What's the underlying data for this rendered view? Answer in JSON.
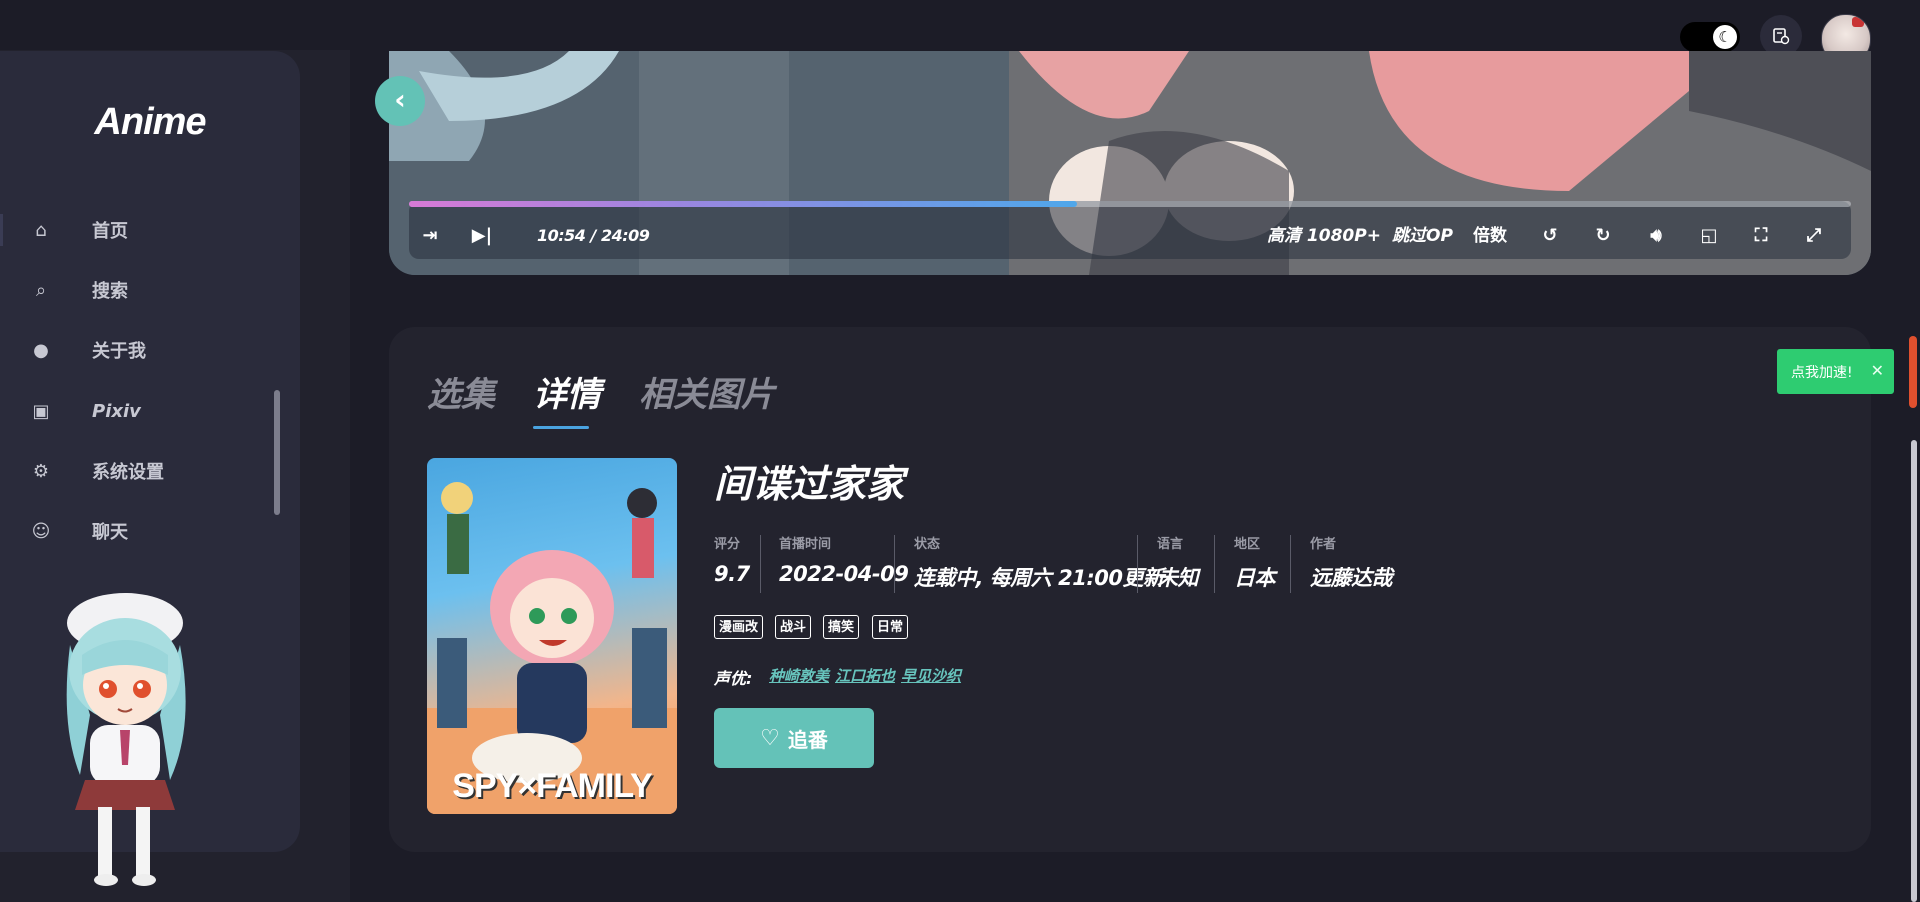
{
  "app": {
    "logo": "Anime"
  },
  "header": {
    "theme_icon": "moon-icon",
    "history_icon": "history-icon",
    "avatar_icon": "avatar-icon"
  },
  "sidebar": {
    "items": [
      {
        "label": "首页",
        "icon": "home-icon"
      },
      {
        "label": "搜索",
        "icon": "search-icon"
      },
      {
        "label": "关于我",
        "icon": "user-icon"
      },
      {
        "label": "Pixiv",
        "icon": "pixiv-icon"
      },
      {
        "label": "系统设置",
        "icon": "gear-icon"
      },
      {
        "label": "聊天",
        "icon": "chat-icon"
      }
    ]
  },
  "player": {
    "current_time": "10:54",
    "separator": "/",
    "duration": "24:09",
    "progress": 0.463,
    "quality_label": "高清 1080P+",
    "skip_op_label": "跳过OP",
    "speed_label": "倍数"
  },
  "details": {
    "tabs": [
      {
        "label": "选集",
        "active": false
      },
      {
        "label": "详情",
        "active": true
      },
      {
        "label": "相关图片",
        "active": false
      }
    ],
    "poster_text": "SPY×FAMILY",
    "title": "间谍过家家",
    "meta": [
      {
        "key": "评分",
        "value": "9.7"
      },
      {
        "key": "首播时间",
        "value": "2022-04-09"
      },
      {
        "key": "状态",
        "value": "连载中, 每周六 21:00更新"
      },
      {
        "key": "语言",
        "value": "未知"
      },
      {
        "key": "地区",
        "value": "日本"
      },
      {
        "key": "作者",
        "value": "远藤达哉"
      }
    ],
    "tags": [
      "漫画改",
      "战斗",
      "搞笑",
      "日常"
    ],
    "cast_label": "声优:",
    "cast": [
      "种崎敦美",
      "江口拓也",
      "早见沙织"
    ],
    "follow_label": "追番"
  },
  "toast": {
    "text": "点我加速!",
    "close": "✕"
  },
  "colors": {
    "accent": "#64c2b8",
    "toast": "#2ecc71",
    "tab_underline": "#4aa3e0"
  }
}
